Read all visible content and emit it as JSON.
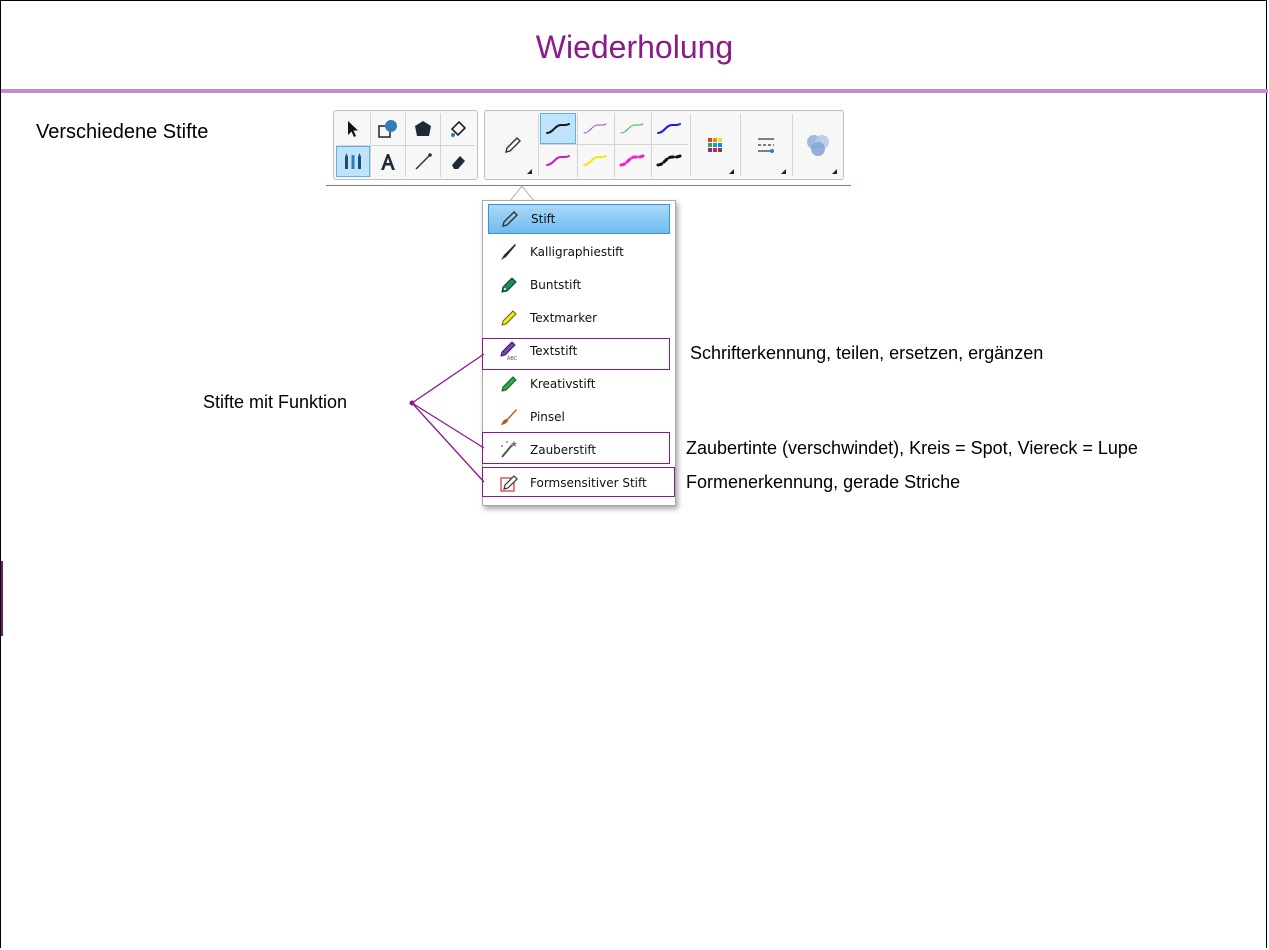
{
  "slide": {
    "title": "Wiederholung",
    "heading": "Verschiedene Stifte"
  },
  "colors": {
    "title": "#8a1c8a",
    "rule": "#c48ccb",
    "highlight": "#8b1a8b",
    "selected_bg": "#bfe3fb"
  },
  "toolbar": {
    "tools": [
      {
        "name": "select-arrow-icon"
      },
      {
        "name": "shapes-icon"
      },
      {
        "name": "polygon-icon"
      },
      {
        "name": "fill-bucket-icon"
      },
      {
        "name": "pens-icon",
        "selected": true
      },
      {
        "name": "text-icon"
      },
      {
        "name": "line-icon"
      },
      {
        "name": "eraser-icon"
      }
    ],
    "pen_type_icon": "pencil-icon",
    "pen_presets": [
      {
        "color": "#1a1a1a",
        "style": "solid",
        "selected": true
      },
      {
        "color": "#a34ac7",
        "style": "thin"
      },
      {
        "color": "#36b33d",
        "style": "thin"
      },
      {
        "color": "#1a1ae6",
        "style": "solid"
      },
      {
        "color": "#d21bb1",
        "style": "solid"
      },
      {
        "color": "#f0e81a",
        "style": "solid"
      },
      {
        "color": "#ee22cc",
        "style": "dashed"
      },
      {
        "color": "#111111",
        "style": "dashed"
      }
    ],
    "extra_buttons": [
      "color-palette-icon",
      "line-style-icon",
      "fill-effects-icon"
    ]
  },
  "pen_menu": {
    "items": [
      {
        "label": "Stift",
        "icon": "pen-icon",
        "selected": true
      },
      {
        "label": "Kalligraphiestift",
        "icon": "calligraphy-pen-icon"
      },
      {
        "label": "Buntstift",
        "icon": "crayon-icon"
      },
      {
        "label": "Textmarker",
        "icon": "highlighter-icon"
      },
      {
        "label": "Textstift",
        "icon": "text-pen-icon",
        "highlighted": true
      },
      {
        "label": "Kreativstift",
        "icon": "creative-pen-icon"
      },
      {
        "label": "Pinsel",
        "icon": "brush-icon"
      },
      {
        "label": "Zauberstift",
        "icon": "magic-pen-icon",
        "highlighted": true
      },
      {
        "label": "Formsensitiver Stift",
        "icon": "shape-pen-icon",
        "highlighted": true
      }
    ]
  },
  "annotations": {
    "callout": "Stifte mit Funktion",
    "textstift": "Schrifterkennung, teilen, ersetzen, ergänzen",
    "zauberstift": "Zaubertinte (verschwindet), Kreis = Spot, Viereck = Lupe",
    "formsensitiv": "Formenerkennung, gerade Striche"
  }
}
